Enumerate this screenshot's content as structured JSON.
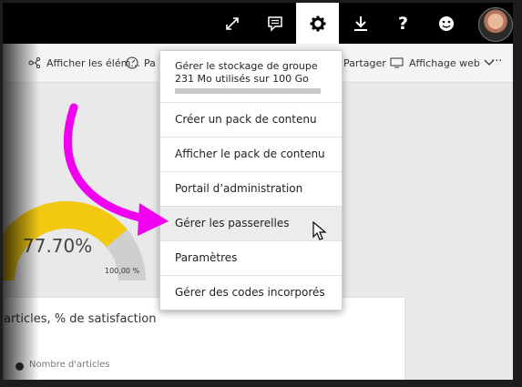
{
  "topbar": {
    "icons": [
      "expand-icon",
      "comment-icon",
      "gear-icon",
      "download-icon",
      "help-icon",
      "smiley-icon"
    ],
    "help_label": "?"
  },
  "toolbar": {
    "show_related": "Afficher les élém...",
    "insights_partial": "Pa",
    "share": "Partager",
    "web_view": "Affichage web",
    "more": "···"
  },
  "gauge": {
    "value": "77.70%",
    "max": "100,00 %",
    "fill_fraction": 0.777,
    "color": "#f2c811"
  },
  "card": {
    "title": "articles, % de satisfaction",
    "legend": "Nombre d'articles"
  },
  "settings_menu": {
    "storage_title": "Gérer le stockage de groupe",
    "storage_usage": "231 Mo utilisés sur 100 Go",
    "items": [
      "Créer un pack de contenu",
      "Afficher le pack de contenu",
      "Portail d’administration",
      "Gérer les passerelles",
      "Paramètres",
      "Gérer des codes incorporés"
    ],
    "hovered_index": 3
  },
  "annotation": {
    "arrow_color": "#f000ee"
  }
}
